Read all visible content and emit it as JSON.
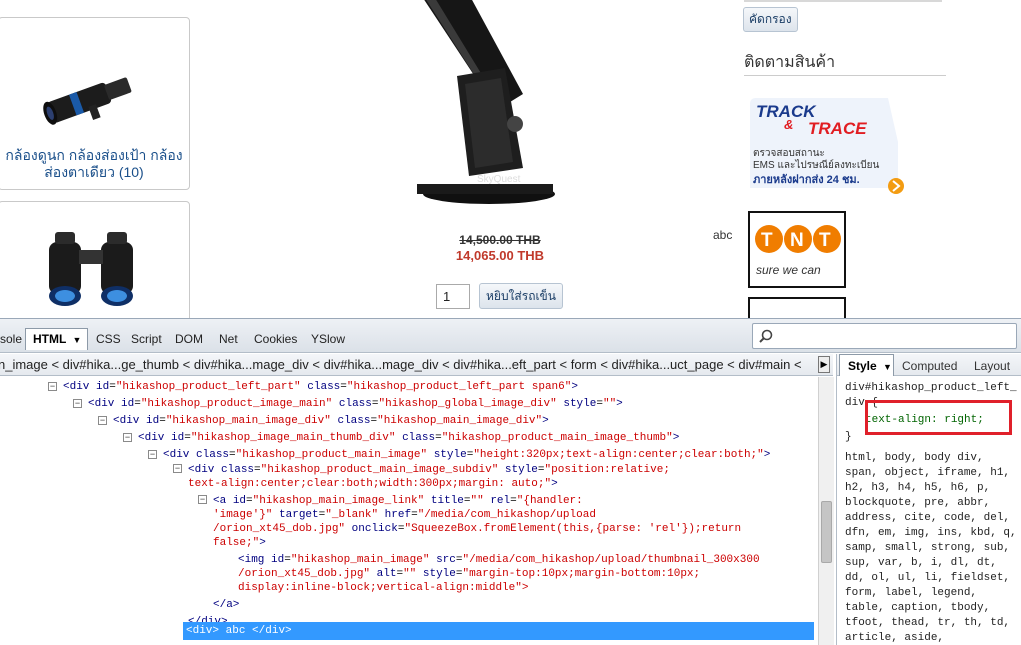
{
  "site": {
    "categories": [
      {
        "label": "กล้องดูนก กล้องส่องเป้า กล้อง ส่องตาเดียว (10)"
      }
    ],
    "product": {
      "old_price": "14,500.00 THB",
      "new_price": "14,065.00 THB",
      "quantity": "1",
      "add_to_cart_label": "หยิบใส่รถเข็น",
      "scope_brand": "SkyQuest"
    },
    "abc_text": "abc",
    "sidebar": {
      "filter_label": "คัดกรอง",
      "follow_title": "ติดตามสินค้า",
      "track_logo": {
        "word1": "TRACK",
        "amp": "&",
        "word2": "TRACE"
      },
      "track_line1": "ตรวจสอบสถานะ",
      "track_line2": "EMS และไปรษณีย์ลงทะเบียน",
      "track_line3": "ภายหลังฝากส่ง 24 ชม.",
      "tnt_logo": "TNT",
      "tnt_tagline": "sure we can"
    }
  },
  "firebug": {
    "tabs": {
      "console": "sole",
      "html": "HTML",
      "css": "CSS",
      "script": "Script",
      "dom": "DOM",
      "net": "Net",
      "cookies": "Cookies",
      "yslow": "YSlow"
    },
    "breadcrumb": "n_image  <  div#hika...ge_thumb  <  div#hika...mage_div  <  div#hika...mage_div  <  div#hika...eft_part  <  form  <  div#hika...uct_page  <  div#main  <",
    "dom_lines": [
      {
        "tag": "div",
        "attrs": [
          [
            "id",
            "hikashop_product_left_part"
          ],
          [
            "class",
            "hikashop_product_left_part span6"
          ]
        ]
      },
      {
        "tag": "div",
        "attrs": [
          [
            "id",
            "hikashop_product_image_main"
          ],
          [
            "class",
            "hikashop_global_image_div"
          ],
          [
            "style",
            ""
          ]
        ]
      },
      {
        "tag": "div",
        "attrs": [
          [
            "id",
            "hikashop_main_image_div"
          ],
          [
            "class",
            "hikashop_main_image_div"
          ]
        ]
      },
      {
        "tag": "div",
        "attrs": [
          [
            "id",
            "hikashop_image_main_thumb_div"
          ],
          [
            "class",
            "hikashop_product_main_image_thumb"
          ]
        ]
      },
      {
        "tag": "div",
        "attrs": [
          [
            "class",
            "hikashop_product_main_image"
          ],
          [
            "style",
            "height:320px;text-align:center;clear:both;"
          ]
        ]
      }
    ],
    "subdiv": {
      "class_val": "hikashop_product_main_image_subdiv",
      "style_val_1": "\"position:relative;",
      "style_val_2": "text-align:center;clear:both;width:300px;margin: auto;\""
    },
    "link": {
      "id_val": "hikashop_main_image_link",
      "title_val": "\"\"",
      "rel_val_1": "\"{handler:",
      "rel_val_2": "'image'}\"",
      "target_val": "\"_blank\"",
      "href_val_1": "\"/media/com_hikashop/upload",
      "href_val_2": "/orion_xt45_dob.jpg\"",
      "onclick_val_1": "\"SqueezeBox.fromElement(this,{parse: 'rel'});return",
      "onclick_val_2": "false;\""
    },
    "img": {
      "id_val": "hikashop_main_image",
      "src_val_1": "\"/media/com_hikashop/upload/thumbnail_300x300",
      "src_val_2": "/orion_xt45_dob.jpg\"",
      "alt_val": "\"\"",
      "style_val_1": "\"margin-top:10px;margin-bottom:10px;",
      "style_val_2": "display:inline-block;vertical-align:middle\">"
    },
    "close_a": "</a>",
    "close_div": "</div>",
    "selected": {
      "open": "<div>",
      "text": "abc",
      "close": "</div>"
    },
    "side": {
      "tab_style": "Style",
      "tab_computed": "Computed",
      "tab_layout": "Layout",
      "selector": "div#hikashop_product_left_",
      "selector_2": "div {",
      "rule": "text-align: right;",
      "close_brace": "}",
      "inherited": "html, body, body div, span, object, iframe, h1, h2, h3, h4, h5, h6, p, blockquote, pre, abbr, address, cite, code, del, dfn, em, img, ins, kbd, q, samp, small, strong, sub, sup, var, b, i, dl, dt, dd, ol, ul, li, fieldset, form, label, legend, table, caption, tbody, tfoot, thead, tr, th, td, article, aside,"
    }
  }
}
